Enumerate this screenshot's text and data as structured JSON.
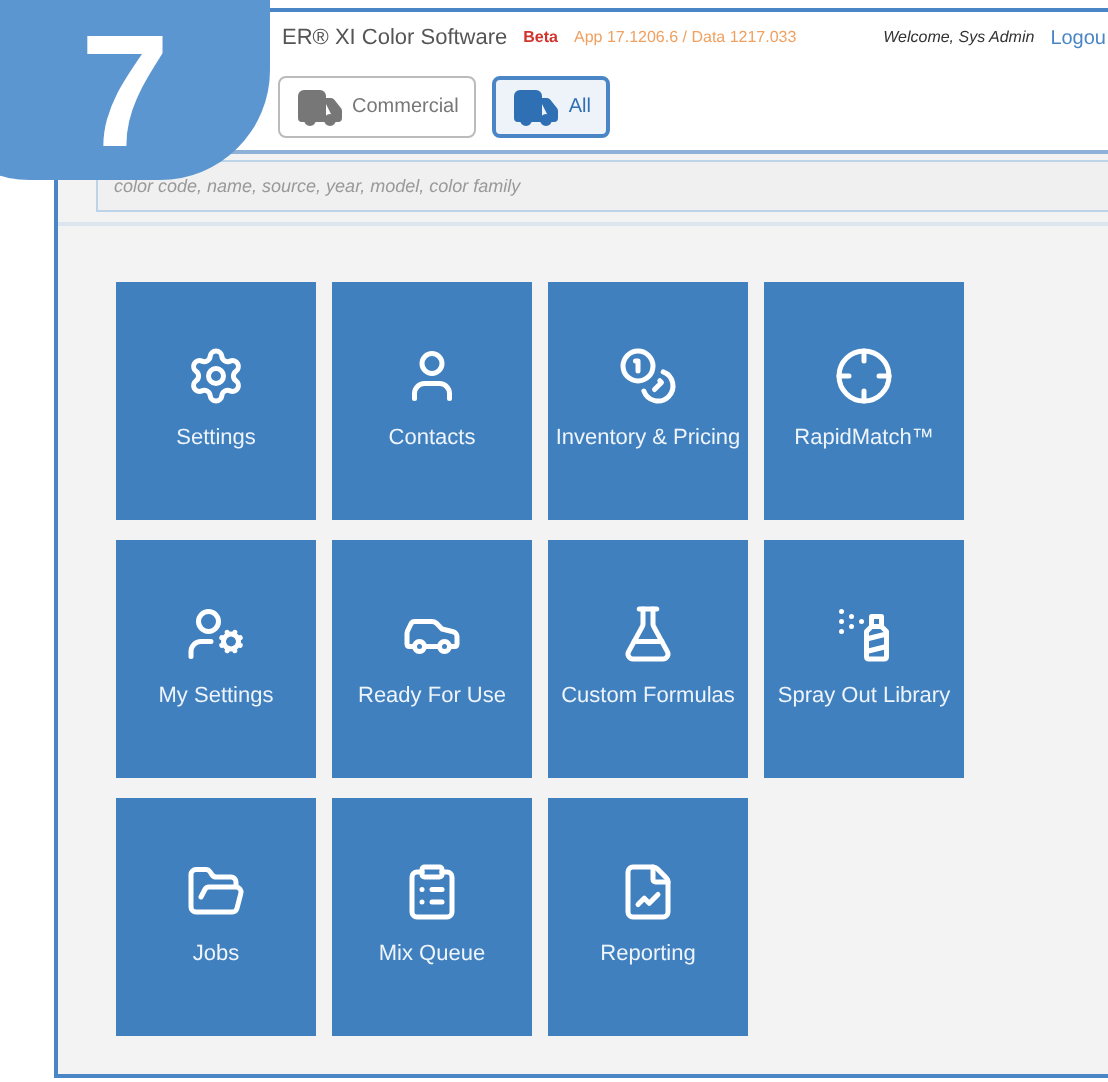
{
  "callout": {
    "number": "7"
  },
  "header": {
    "title": "ER® XI Color Software",
    "beta": "Beta",
    "version": "App 17.1206.6 / Data 1217.033",
    "welcome": "Welcome, Sys Admin",
    "logout": "Logou"
  },
  "tabs": [
    {
      "label": "Commercial",
      "selected": false
    },
    {
      "label": "All",
      "selected": true
    }
  ],
  "search": {
    "placeholder": "color code, name, source, year, model, color family"
  },
  "tiles": [
    {
      "label": "Settings"
    },
    {
      "label": "Contacts"
    },
    {
      "label": "Inventory & Pricing"
    },
    {
      "label": "RapidMatch™"
    },
    {
      "label": "My Settings"
    },
    {
      "label": "Ready For Use"
    },
    {
      "label": "Custom Formulas"
    },
    {
      "label": "Spray Out Library"
    },
    {
      "label": "Jobs"
    },
    {
      "label": "Mix Queue"
    },
    {
      "label": "Reporting"
    }
  ]
}
